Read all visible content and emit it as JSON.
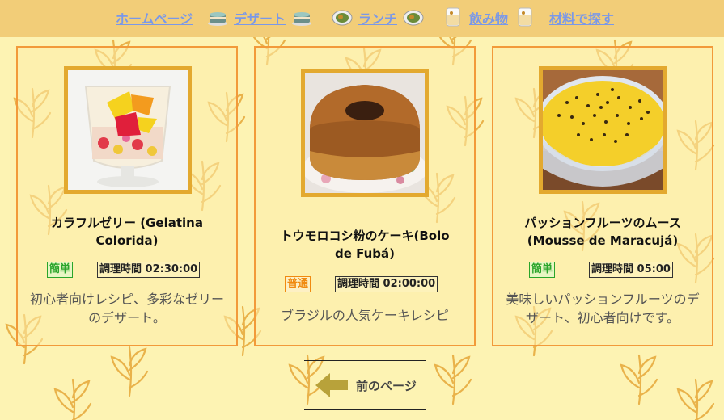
{
  "nav": {
    "items": [
      {
        "label": "ホームページ",
        "icon": null
      },
      {
        "label": "デザート",
        "icon": "cake-icon"
      },
      {
        "label": "ランチ",
        "icon": "dish-icon"
      },
      {
        "label": "飲み物",
        "icon": "drink-glass-icon"
      },
      {
        "label": "材料で探す",
        "icon": null
      }
    ]
  },
  "recipes": [
    {
      "title": "カラフルゼリー (Gelatina Colorida)",
      "difficulty": "簡単",
      "cook_time": "調理時間 02:30:00",
      "description": "初心者向けレシピ、多彩なゼリーのデザート。",
      "photo": "colorful-jelly-photo"
    },
    {
      "title": "トウモロコシ粉のケーキ(Bolo de Fubá)",
      "difficulty": "普通",
      "cook_time": "調理時間 02:00:00",
      "description": "ブラジルの人気ケーキレシピ",
      "photo": "corn-cake-photo"
    },
    {
      "title": "パッションフルーツのムース (Mousse de Maracujá)",
      "difficulty": "簡単",
      "cook_time": "調理時間 05:00",
      "description": "美味しいパッションフルーツのデザート、初心者向けです。",
      "photo": "passion-fruit-mousse-photo"
    }
  ],
  "pager": {
    "prev_label": "前のページ"
  },
  "colors": {
    "nav_bg": "#f2cd78",
    "page_bg": "#fdf3b3",
    "link": "#7a98e8",
    "card_border": "#f29a3a",
    "photo_frame": "#e3a92f",
    "easy": "#2aa52a",
    "normal": "#f08a10",
    "arrow": "#b8a23a"
  }
}
